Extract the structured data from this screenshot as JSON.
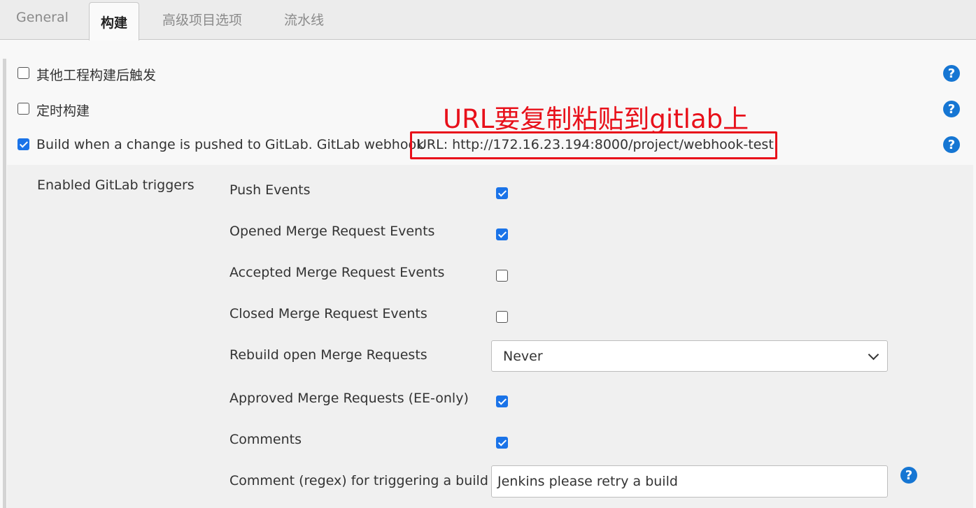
{
  "tabs": [
    {
      "label": "General",
      "active": false
    },
    {
      "label": "构建",
      "active": true
    },
    {
      "label": "高级项目选项",
      "active": false
    },
    {
      "label": "流水线",
      "active": false
    }
  ],
  "build_triggers": [
    {
      "label": "其他工程构建后触发",
      "checked": false
    },
    {
      "label": "定时构建",
      "checked": false
    },
    {
      "label": "Build when a change is pushed to GitLab. GitLab webhook",
      "checked": true,
      "url": "URL: http://172.16.23.194:8000/project/webhook-test"
    }
  ],
  "annotation": "URL要复制粘贴到gitlab上",
  "gitlab": {
    "section_label": "Enabled GitLab triggers",
    "triggers": [
      {
        "label": "Push Events",
        "checked": true
      },
      {
        "label": "Opened Merge Request Events",
        "checked": true
      },
      {
        "label": "Accepted Merge Request Events",
        "checked": false
      },
      {
        "label": "Closed Merge Request Events",
        "checked": false
      },
      {
        "label": "Rebuild open Merge Requests",
        "value": "Never"
      },
      {
        "label": "Approved Merge Requests (EE-only)",
        "checked": true
      },
      {
        "label": "Comments",
        "checked": true
      },
      {
        "label": "Comment (regex) for triggering a build",
        "value": "Jenkins please retry a build"
      }
    ]
  },
  "help_glyph": "?",
  "colors": {
    "accent": "#1a73e8",
    "help": "#1676d3",
    "annotation": "#e8101a"
  }
}
